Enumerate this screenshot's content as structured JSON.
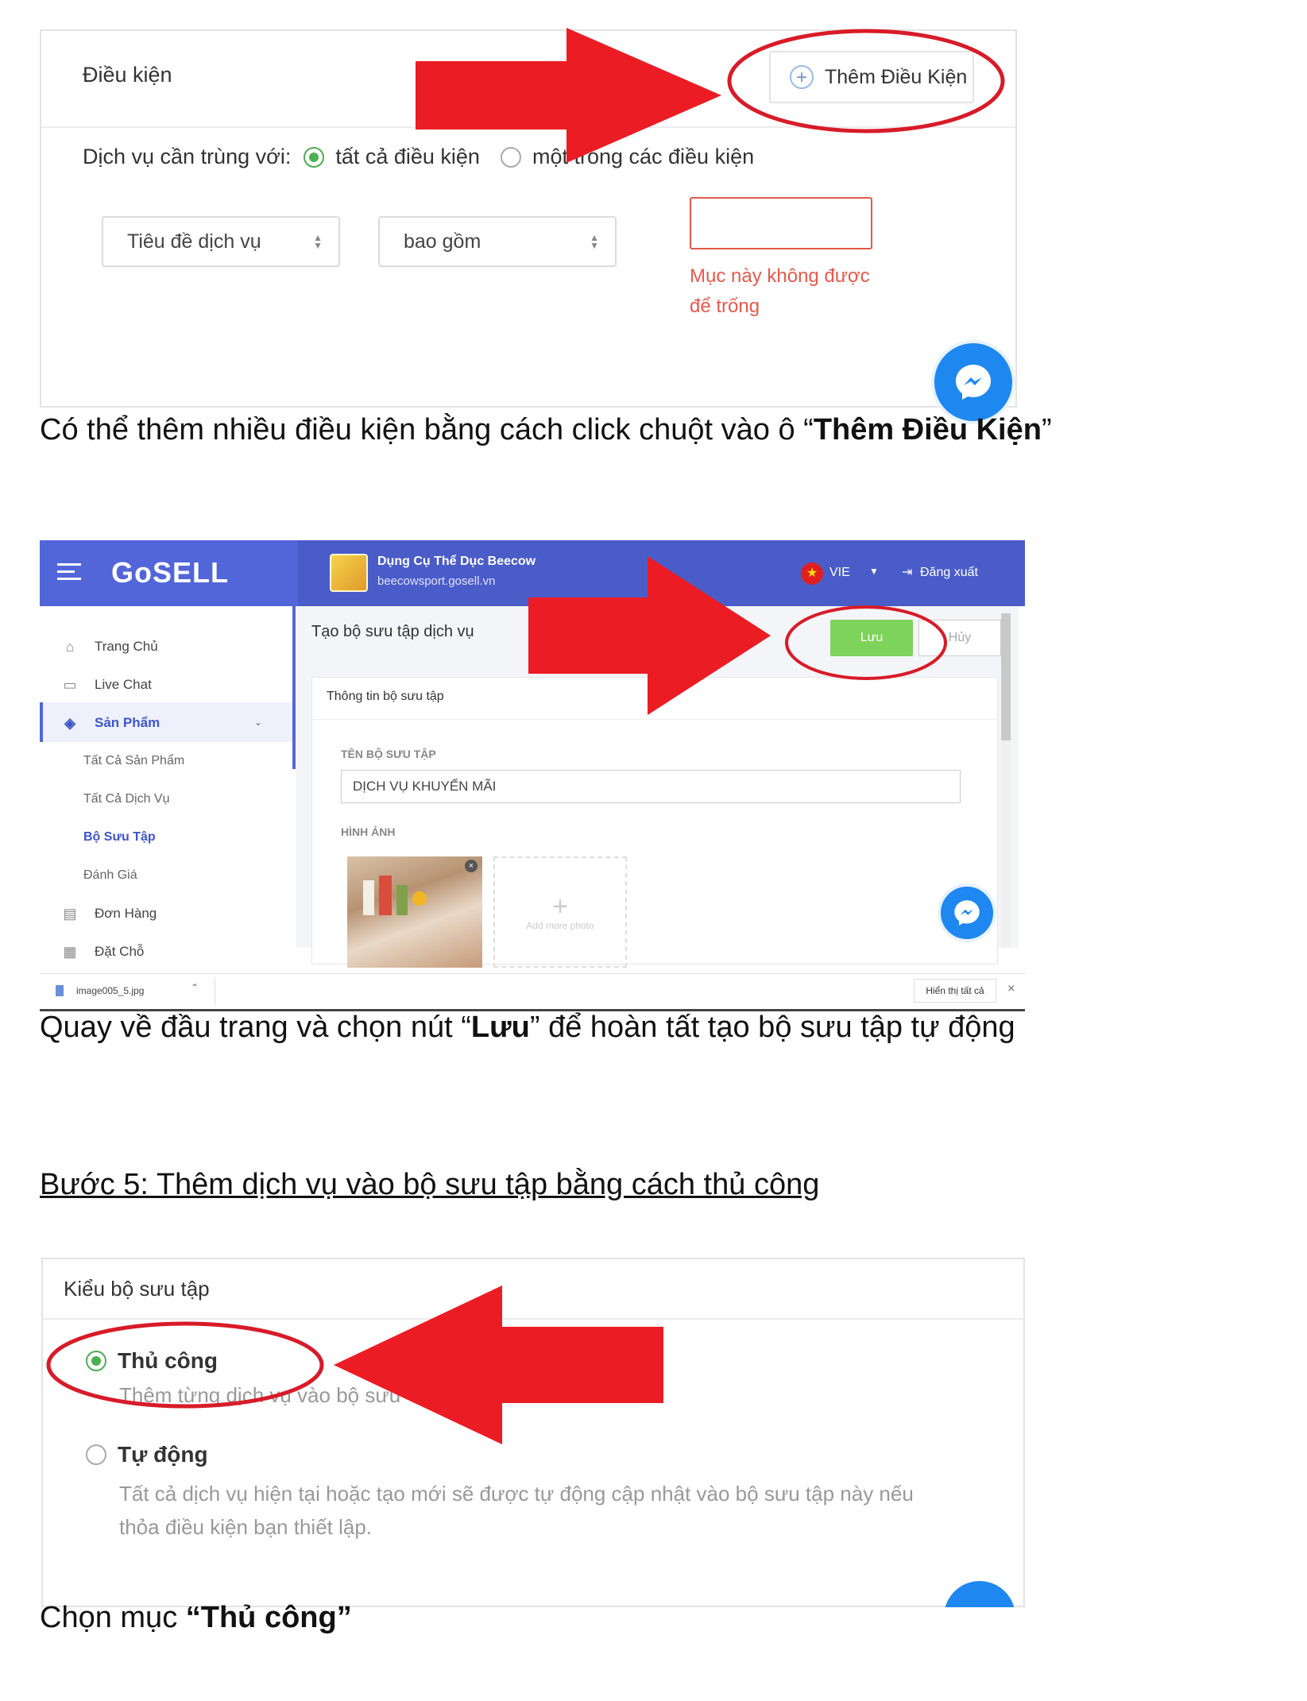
{
  "section1": {
    "panel_title": "Điều kiện",
    "add_button_label": "Thêm Điều Kiện",
    "match_label": "Dịch vụ cần trùng với:",
    "option_all": "tất cả điều kiện",
    "option_any": "một trong các điều kiện",
    "field_select": "Tiêu đề dịch vụ",
    "operator_select": "bao gồm",
    "value_input": "",
    "error_line1": "Mục này không được",
    "error_line2": "để trống",
    "caption_prefix": "Có thể thêm nhiều điều kiện bằng cách click chuột vào ô “",
    "caption_bold": "Thêm Điều Kiện",
    "caption_suffix": "”"
  },
  "section2": {
    "brand": "GoSELL",
    "store_name": "Dụng Cụ Thể Dục Beecow",
    "store_url": "beecowsport.gosell.vn",
    "language": "VIE",
    "logout": "Đăng xuất",
    "sidebar": [
      {
        "label": "Trang Chủ",
        "icon": "home-icon"
      },
      {
        "label": "Live Chat",
        "icon": "chat-icon"
      },
      {
        "label": "Sản Phẩm",
        "icon": "tag-icon"
      },
      {
        "label": "Tất Cả Sản Phẩm"
      },
      {
        "label": "Tất Cả Dịch Vụ"
      },
      {
        "label": "Bộ Sưu Tập"
      },
      {
        "label": "Đánh Giá"
      },
      {
        "label": "Đơn Hàng",
        "icon": "receipt-icon"
      },
      {
        "label": "Đặt Chỗ",
        "icon": "calendar-icon"
      }
    ],
    "page_title": "Tạo bộ sưu tập dịch vụ",
    "save_label": "Lưu",
    "cancel_label": "Hủy",
    "card_title": "Thông tin bộ sưu tập",
    "name_label": "TÊN BỘ SƯU TẬP",
    "name_value": "DỊCH VỤ KHUYẾN MÃI",
    "image_label": "HÌNH ẢNH",
    "add_photo": "Add more photo",
    "download_file": "image005_5.jpg",
    "show_all": "Hiển thị tất cả",
    "caption_prefix": "Quay về đầu trang và chọn nút “",
    "caption_bold": "Lưu",
    "caption_suffix": "” để hoàn tất tạo bộ sưu tập tự động"
  },
  "step5_heading": "Bước 5: Thêm dịch vụ vào bộ sưu tập bằng cách thủ công",
  "section3": {
    "panel_title": "Kiểu bộ sưu tập",
    "manual_title": "Thủ công",
    "manual_desc": "Thêm từng dịch vụ vào bộ sưu",
    "auto_title": "Tự động",
    "auto_desc_line1": "Tất cả dịch vụ hiện tại hoặc tạo mới sẽ được tự động cập nhật vào bộ sưu tập này nếu",
    "auto_desc_line2": "thỏa điều kiện bạn thiết lập.",
    "caption_prefix": "Chọn mục ",
    "caption_bold": "“Thủ công”"
  },
  "colors": {
    "annotation_red": "#ec1c24",
    "radio_green": "#4caf50",
    "header_blue": "#4a5cc8",
    "save_green": "#7ed35b",
    "error_red": "#e8594b",
    "messenger_blue": "#1e88f0"
  }
}
